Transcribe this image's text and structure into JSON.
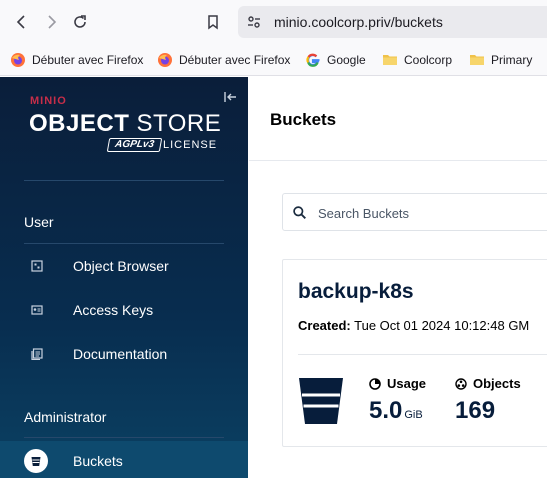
{
  "browser": {
    "url": "minio.coolcorp.priv/buckets",
    "bookmarks": [
      {
        "label": "Débuter avec Firefox",
        "icon": "firefox-icon"
      },
      {
        "label": "Débuter avec Firefox",
        "icon": "firefox-icon"
      },
      {
        "label": "Google",
        "icon": "google-icon"
      },
      {
        "label": "Coolcorp",
        "icon": "folder-icon"
      },
      {
        "label": "Primary",
        "icon": "folder-icon"
      }
    ]
  },
  "sidebar": {
    "logo": {
      "brand": "MINIO",
      "product_bold": "OBJECT",
      "product": "STORE",
      "license_badge": "AGPLv3",
      "license": "LICENSE"
    },
    "sections": [
      {
        "label": "User",
        "items": [
          {
            "label": "Object Browser",
            "icon": "object-browser-icon"
          },
          {
            "label": "Access Keys",
            "icon": "access-keys-icon"
          },
          {
            "label": "Documentation",
            "icon": "documentation-icon"
          }
        ]
      },
      {
        "label": "Administrator",
        "items": [
          {
            "label": "Buckets",
            "icon": "bucket-icon",
            "active": true
          }
        ]
      }
    ]
  },
  "main": {
    "title": "Buckets",
    "search": {
      "placeholder": "Search Buckets",
      "value": ""
    },
    "buckets": [
      {
        "name": "backup-k8s",
        "created_label": "Created:",
        "created_value": "Tue Oct 01 2024 10:12:48 GM",
        "usage_label": "Usage",
        "usage_value": "5.0",
        "usage_unit": "GiB",
        "objects_label": "Objects",
        "objects_value": "169"
      }
    ]
  },
  "colors": {
    "sidebar_top": "#0a1e3a",
    "sidebar_bottom": "#0b4163",
    "brand_red": "#c72e49",
    "navy_text": "#071d3b"
  }
}
